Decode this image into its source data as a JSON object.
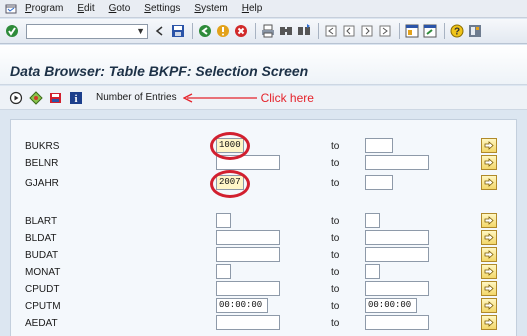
{
  "menu": {
    "items": [
      "Program",
      "Edit",
      "Goto",
      "Settings",
      "System",
      "Help"
    ]
  },
  "toolbar": {
    "icons": [
      "enter-icon",
      "back-icon",
      "save-icon",
      "back-arrow-icon",
      "exit-icon",
      "cancel-icon",
      "print-icon",
      "find-icon",
      "find-next-icon",
      "first-page-icon",
      "prev-page-icon",
      "next-page-icon",
      "last-page-icon",
      "create-session-icon",
      "shortcut-icon",
      "help-icon",
      "layout-icon"
    ]
  },
  "title": "Data Browser: Table BKPF: Selection Screen",
  "apptoolbar": {
    "number_of_entries": "Number of Entries",
    "annotation": "Click here"
  },
  "colors": {
    "annotation": "#e5232b",
    "highlight_circle": "#d2202f",
    "title_text": "#1d3147"
  },
  "fields": [
    {
      "label": "BUKRS",
      "from": "1000",
      "to": ""
    },
    {
      "label": "BELNR",
      "from": "",
      "to": ""
    },
    {
      "label": "GJAHR",
      "from": "2007",
      "to": ""
    },
    {
      "label": "BLART",
      "from": "",
      "to": ""
    },
    {
      "label": "BLDAT",
      "from": "",
      "to": ""
    },
    {
      "label": "BUDAT",
      "from": "",
      "to": ""
    },
    {
      "label": "MONAT",
      "from": "",
      "to": ""
    },
    {
      "label": "CPUDT",
      "from": "",
      "to": ""
    },
    {
      "label": "CPUTM",
      "from": "00:00:00",
      "to": "00:00:00"
    },
    {
      "label": "AEDAT",
      "from": "",
      "to": ""
    }
  ],
  "to_label": "to"
}
